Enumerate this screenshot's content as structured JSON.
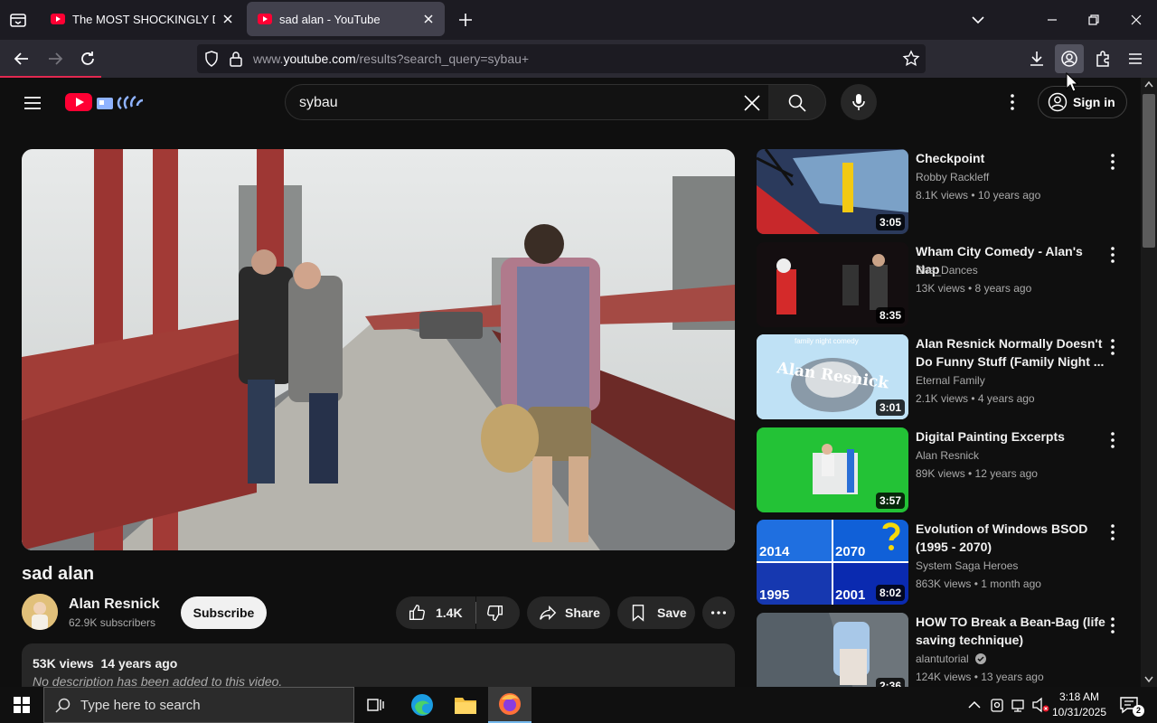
{
  "browser": {
    "tabs": [
      {
        "label": "The MOST SHOCKINGLY Dirty C"
      },
      {
        "label": "sad alan - YouTube"
      }
    ],
    "url_prefix": "www.",
    "url_domain": "youtube.com",
    "url_path": "/results?search_query=sybau+"
  },
  "header": {
    "search_value": "sybau",
    "signin_label": "Sign in"
  },
  "video": {
    "title": "sad alan",
    "channel": "Alan Resnick",
    "subscribers": "62.9K subscribers",
    "subscribe_label": "Subscribe",
    "likes": "1.4K",
    "share_label": "Share",
    "save_label": "Save",
    "views": "53K views",
    "age": "14 years ago",
    "description": "No description has been added to this video."
  },
  "recommendations": [
    {
      "title": "Checkpoint",
      "channel": "Robby Rackleff",
      "meta": "8.1K views • 10 years ago",
      "duration": "3:05",
      "verified": false
    },
    {
      "title": "Wham City Comedy - Alan's Nap",
      "channel": "She_Dances",
      "meta": "13K views • 8 years ago",
      "duration": "8:35",
      "verified": false
    },
    {
      "title": "Alan Resnick Normally Doesn't Do Funny Stuff (Family Night ...",
      "channel": "Eternal Family",
      "meta": "2.1K views • 4 years ago",
      "duration": "3:01",
      "verified": false,
      "thumb_text_top": "family night comedy",
      "thumb_text": "Alan Resnick"
    },
    {
      "title": "Digital Painting Excerpts",
      "channel": "Alan Resnick",
      "meta": "89K views • 12 years ago",
      "duration": "3:57",
      "verified": false
    },
    {
      "title": "Evolution of Windows BSOD (1995 - 2070)",
      "channel": "System Saga Heroes",
      "meta": "863K views • 1 month ago",
      "duration": "8:02",
      "verified": false,
      "thumb_years": [
        "2014",
        "2070",
        "1995",
        "2001"
      ]
    },
    {
      "title": "HOW TO Break a Bean-Bag (life saving technique)",
      "channel": "alantutorial",
      "meta": "124K views • 13 years ago",
      "duration": "2:36",
      "verified": true
    }
  ],
  "taskbar": {
    "search_placeholder": "Type here to search",
    "time": "3:18 AM",
    "date": "10/31/2025",
    "notifications": "2"
  },
  "colors": {
    "yt_bg": "#0f0f0f",
    "yt_red": "#ff0033",
    "browser_chrome": "#2b2a33",
    "tab_strip": "#1c1b22",
    "taskbar": "#101010"
  }
}
